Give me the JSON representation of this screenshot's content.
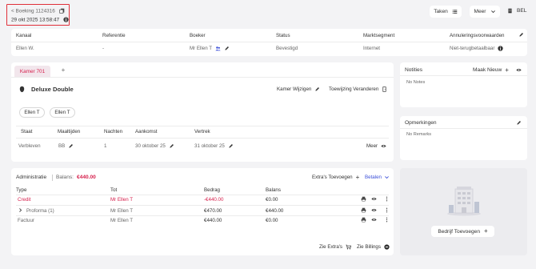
{
  "header": {
    "booking_label": "< Boeking 1124316",
    "datetime": "29 okt 2025 13:58:47",
    "taken_label": "Taken",
    "meer_label": "Meer",
    "language": "BEL"
  },
  "booking_table": {
    "columns": [
      "Kanaal",
      "Referentie",
      "Boeker",
      "Status",
      "Marktsegment",
      "Annuleringsvoorwaarden"
    ],
    "values": [
      "Ellen W.",
      "-",
      "Mr Ellen T",
      "Bevestigd",
      "Internet",
      "Niet-terugbetaalbaar"
    ]
  },
  "room": {
    "tab_label": "Kamer 701",
    "add_tab": "+",
    "room_type": "Deluxe Double",
    "change_room": "Kamer Wijzigen",
    "change_assignment": "Toewijzing Veranderen",
    "guests": [
      "Ellen T",
      "Ellen T"
    ],
    "stay_columns": [
      "Staat",
      "Maaltijden",
      "Nachten",
      "Aankomst",
      "Vertrek"
    ],
    "stay_values": [
      "Verbleven",
      "BB",
      "1",
      "30 oktober 25",
      "31 oktober 25"
    ],
    "more_label": "Meer"
  },
  "notes": {
    "title": "Notities",
    "new_label": "Maak Nieuw",
    "empty": "No Notes"
  },
  "remarks": {
    "title": "Opmerkingen",
    "empty": "No Remarks"
  },
  "company": {
    "add_label": "Bedrijf Toevoegen"
  },
  "admin": {
    "title": "Administratie",
    "balance_label": "Balans:",
    "balance_value": "€440.00",
    "extras_label": "Extra's Toevoegen",
    "pay_label": "Betalen",
    "columns": [
      "Type",
      "Tot",
      "Bedrag",
      "Balans"
    ],
    "rows": [
      {
        "type": "Credit",
        "to": "Mr Ellen T",
        "amount": "-€440.00",
        "balance": "€0.00"
      },
      {
        "type": "Proforma (1)",
        "to": "Mr Ellen T",
        "amount": "€470.00",
        "balance": "€440.00"
      },
      {
        "type": "Factuur",
        "to": "Mr Ellen T",
        "amount": "€440.00",
        "balance": "€0.00"
      }
    ],
    "see_extras": "Zie Extra's",
    "see_billings": "Zie Billings"
  },
  "colors": {
    "accent": "#d6214d",
    "link_blue": "#3b4fd8",
    "highlight_box": "#e0303a"
  }
}
